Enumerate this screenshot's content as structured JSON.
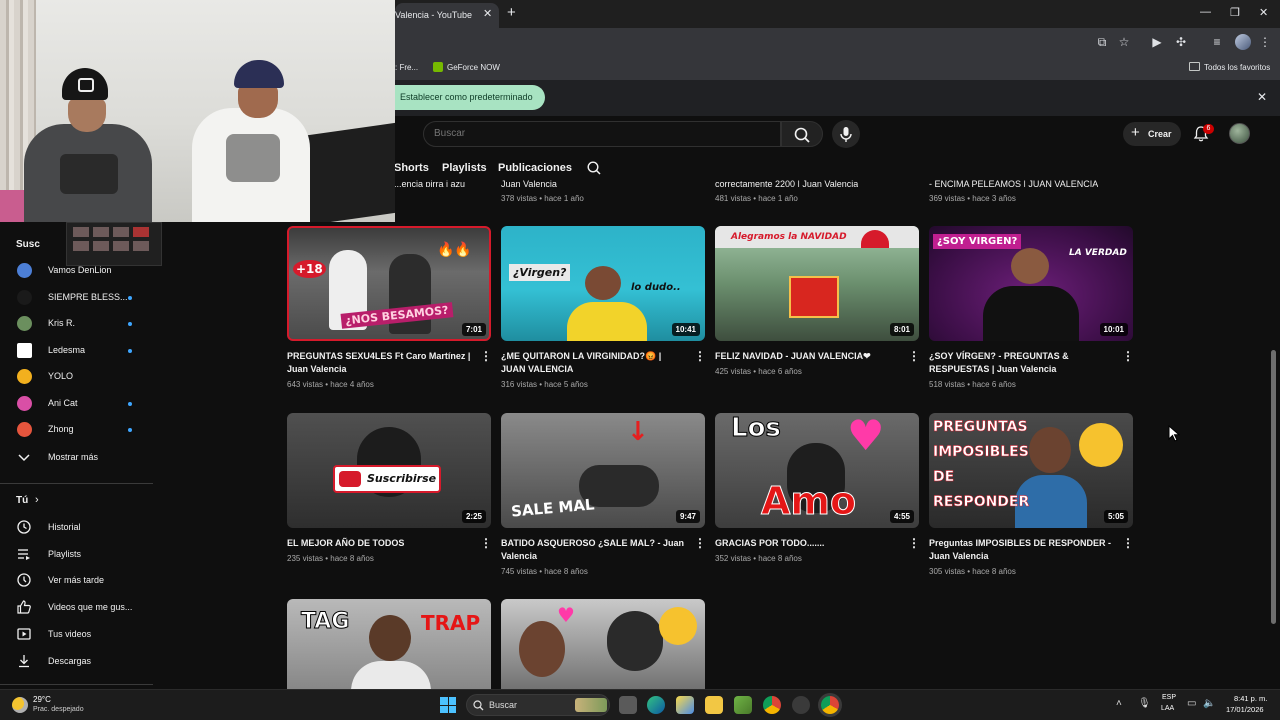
{
  "browser": {
    "tab_title": "Valencia - YouTube",
    "bookmarks": [
      {
        "label": ": Fre..."
      },
      {
        "label": "GeForce NOW"
      }
    ],
    "favorites_label": "Todos los favoritos",
    "default_prompt": "Establecer como predeterminado"
  },
  "header": {
    "search_placeholder": "Buscar",
    "create_label": "Crear",
    "notification_count": "6"
  },
  "channel_tabs": [
    "Shorts",
    "Playlists",
    "Publicaciones"
  ],
  "sidebar": {
    "subscriptions_heading": "Susc",
    "subscriptions": [
      {
        "name": "Vamos DenLion",
        "color": "#4c7fd6",
        "new": false
      },
      {
        "name": "SIEMPRE BLESS...",
        "color": "#1a1a1a",
        "new": true
      },
      {
        "name": "Kris R.",
        "color": "#6b8f5e",
        "new": true
      },
      {
        "name": "Ledesma",
        "color": "#ffffff",
        "new": true
      },
      {
        "name": "YOLO",
        "color": "#f2b01e",
        "new": false
      },
      {
        "name": "Ani Cat",
        "color": "#d94fa6",
        "new": true
      },
      {
        "name": "Zhong",
        "color": "#e5553d",
        "new": true
      }
    ],
    "show_more": "Mostrar más",
    "you_heading": "Tú",
    "you_items": [
      {
        "label": "Historial",
        "icon": "history-icon"
      },
      {
        "label": "Playlists",
        "icon": "playlists-icon"
      },
      {
        "label": "Ver más tarde",
        "icon": "watch-later-icon"
      },
      {
        "label": "Videos que me gus...",
        "icon": "thumbs-up-icon"
      },
      {
        "label": "Tus videos",
        "icon": "your-videos-icon"
      },
      {
        "label": "Descargas",
        "icon": "downloads-icon"
      }
    ]
  },
  "top_row": [
    {
      "title_fragment": "...encia pirra i azu",
      "meta": ""
    },
    {
      "title_fragment": "Juan Valencia",
      "meta": "378 vistas • hace 1 año"
    },
    {
      "title_fragment": "correctamente 2200 | Juan Valencia",
      "meta": "481 vistas • hace 1 año"
    },
    {
      "title_fragment": "- ENCIMA PELEAMOS | JUAN VALENCIA",
      "meta": "369 vistas • hace 3 años"
    }
  ],
  "videos": [
    {
      "title": "PREGUNTAS SEXU4LES Ft Caro Martínez | Juan Valencia",
      "meta": "643 vistas • hace 4 años",
      "duration": "7:01",
      "thumb_text": "¿NOS BESAMOS?",
      "thumb_badge": "+18"
    },
    {
      "title": "¿ME QUITARON LA VIRGINIDAD?😡 | JUAN VALENCIA",
      "meta": "316 vistas • hace 5 años",
      "duration": "10:41",
      "thumb_text": "¿Virgen?",
      "thumb_badge": "lo dudo.."
    },
    {
      "title": "FELIZ NAVIDAD - JUAN VALENCIA❤",
      "meta": "425 vistas • hace 6 años",
      "duration": "8:01",
      "thumb_text": "Alegramos la NAVIDAD",
      "thumb_badge": ""
    },
    {
      "title": "¿SOY VÍRGEN? - PREGUNTAS & RESPUESTAS | Juan Valencia",
      "meta": "518 vistas • hace 6 años",
      "duration": "10:01",
      "thumb_text": "¿SOY VIRGEN?",
      "thumb_badge": "LA VERDAD"
    },
    {
      "title": "EL MEJOR AÑO DE TODOS",
      "meta": "235 vistas • hace 8 años",
      "duration": "2:25",
      "thumb_text": "Suscribirse",
      "thumb_badge": ""
    },
    {
      "title": "BATIDO ASQUEROSO ¿SALE MAL? - Juan Valencia",
      "meta": "745 vistas • hace 8 años",
      "duration": "9:47",
      "thumb_text": "SALE MAL",
      "thumb_badge": ""
    },
    {
      "title": "GRACIAS POR TODO.......",
      "meta": "352 vistas • hace 8 años",
      "duration": "4:55",
      "thumb_text": "Amo",
      "thumb_badge": "Los"
    },
    {
      "title": "Preguntas IMPOSIBLES DE RESPONDER - Juan Valencia",
      "meta": "305 vistas • hace 8 años",
      "duration": "5:05",
      "thumb_text": "PREGUNTAS IMPOSIBLES DE RESPONDER",
      "thumb_badge": ""
    },
    {
      "title": "",
      "meta": "",
      "duration": "",
      "thumb_text": "TAG",
      "thumb_badge": "TRAP"
    },
    {
      "title": "",
      "meta": "",
      "duration": "",
      "thumb_text": "",
      "thumb_badge": ""
    }
  ],
  "taskbar": {
    "weather_temp": "29°C",
    "weather_desc": "Prac. despejado",
    "search_label": "Buscar",
    "lang_line1": "ESP",
    "lang_line2": "LAA",
    "time": "8:41 p. m.",
    "date": "17/01/2026"
  }
}
